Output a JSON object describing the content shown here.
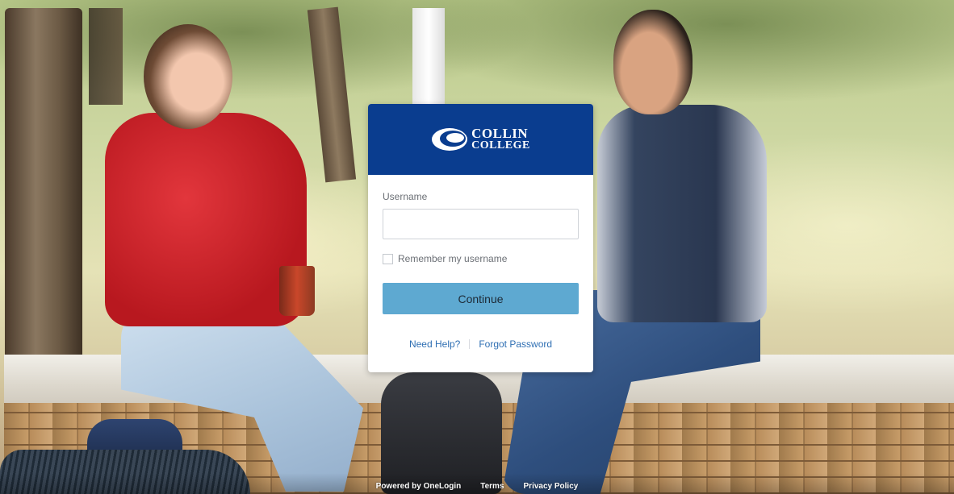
{
  "brand": {
    "logo_line1": "COLLIN",
    "logo_line2": "COLLEGE",
    "header_color": "#0a3d8f"
  },
  "login": {
    "username_label": "Username",
    "username_value": "",
    "remember_label": "Remember my username",
    "remember_checked": false,
    "continue_label": "Continue",
    "button_color": "#5ea9d1"
  },
  "links": {
    "need_help": "Need Help?",
    "forgot_password": "Forgot Password"
  },
  "footer": {
    "powered_by": "Powered by OneLogin",
    "terms": "Terms",
    "privacy": "Privacy Policy"
  }
}
